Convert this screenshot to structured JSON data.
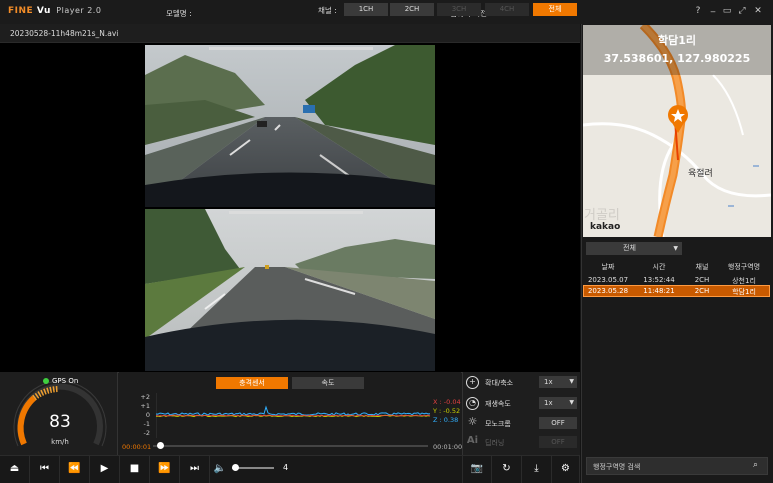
{
  "titlebar": {
    "brand": "FINE",
    "brand_suffix": "Vu",
    "version": "Player 2.0",
    "model_label": "모델명 :",
    "firmware_label": "펌웨어 버전 :",
    "help_icon": "?",
    "min_icon": "_",
    "restore_icon": "▭",
    "max_icon": "⤢",
    "close_icon": "✕"
  },
  "file": {
    "name": "20230528-11h48m21s_N.avi",
    "channel_label": "채널 :",
    "channels": [
      {
        "label": "1CH",
        "state": "normal"
      },
      {
        "label": "2CH",
        "state": "normal"
      },
      {
        "label": "3CH",
        "state": "disabled"
      },
      {
        "label": "4CH",
        "state": "disabled"
      },
      {
        "label": "전체",
        "state": "active"
      }
    ]
  },
  "gps": {
    "status": "GPS On",
    "speed": "83",
    "unit": "km/h"
  },
  "graph": {
    "tabs": [
      "충격센서",
      "속도"
    ],
    "y_ticks": [
      "+2",
      "+1",
      "0",
      "-1",
      "-2"
    ],
    "x_value": "X : -0.04",
    "y_value": "Y : -0.52",
    "z_value": "Z : 0.38",
    "time_start": "00:00:01",
    "time_end": "00:01:00",
    "colors": {
      "x": "#e04040",
      "y": "#c8d000",
      "z": "#30b0ff"
    }
  },
  "controls": {
    "zoom_label": "확대/축소",
    "zoom_value": "1x",
    "speed_label": "재생속도",
    "speed_value": "1x",
    "mono_label": "모노크롬",
    "mono_value": "OFF",
    "ai_label": "딥러닝",
    "ai_value": "OFF"
  },
  "playback": {
    "volume": "4"
  },
  "map": {
    "place": "학담1리",
    "coords": "37.538601, 127.980225",
    "label_road": "육절려",
    "label_area": "거골리",
    "provider": "kakao"
  },
  "list": {
    "filter": "전체",
    "headers": [
      "날짜",
      "시간",
      "채널",
      "행정구역명"
    ],
    "rows": [
      {
        "date": "2023.05.07",
        "time": "13:52:44",
        "ch": "2CH",
        "area": "상천1리",
        "selected": false
      },
      {
        "date": "2023.05.28",
        "time": "11:48:21",
        "ch": "2CH",
        "area": "학담1리",
        "selected": true
      }
    ]
  },
  "search": {
    "placeholder": "행정구역명 검색"
  }
}
